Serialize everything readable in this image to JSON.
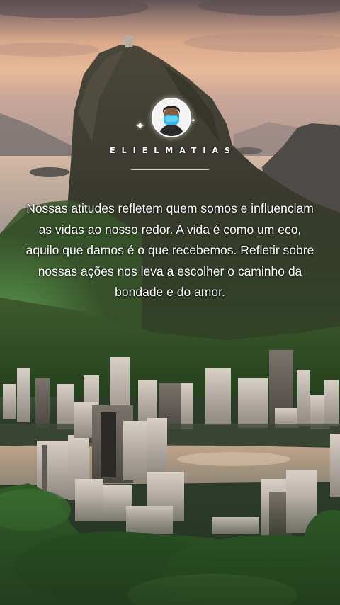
{
  "profile": {
    "username": "ELIELMATIAS",
    "avatar_icon": "person-avatar-icon",
    "sparkle_icon": "sparkle-icon"
  },
  "quote": {
    "text": "Nossas atitudes refletem quem somos e influenciam as vidas ao nosso redor. A vida é como um eco, aquilo que damos é o que recebemos. Refletir sobre nossas ações nos leva a escolher o caminho da bondade e do amor."
  },
  "colors": {
    "sky_top": "#6b5a5e",
    "sky_glow": "#e9b48f",
    "mountain": "#3d3b2f",
    "forest": "#2d5a26",
    "water": "#b7a79a",
    "text": "#ffffff"
  }
}
